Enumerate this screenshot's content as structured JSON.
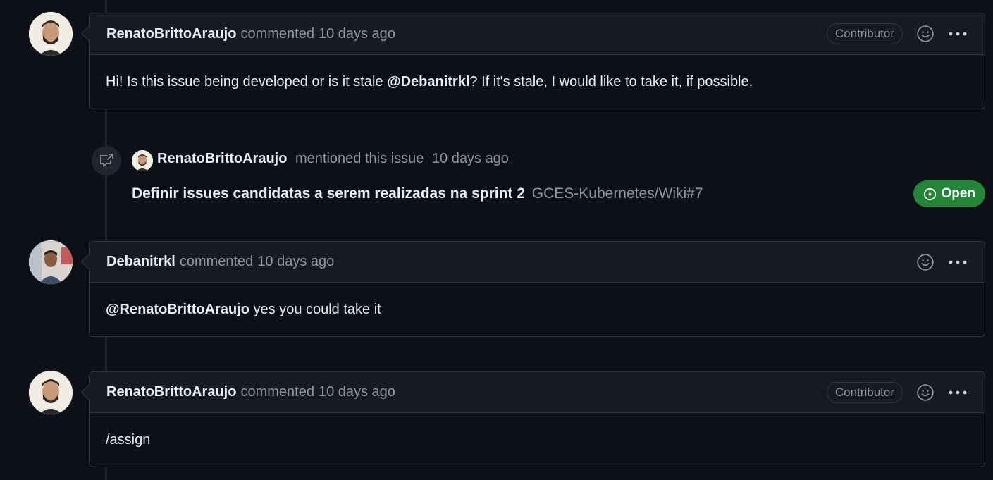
{
  "comments": [
    {
      "author": "RenatoBrittoAraujo",
      "action": "commented",
      "time": "10 days ago",
      "badge": "Contributor",
      "body": {
        "before": "Hi! Is this issue being developed or is it stale ",
        "mention": "@Debanitrkl",
        "after": "? If it's stale, I would like to take it, if possible."
      }
    },
    {
      "author": "Debanitrkl",
      "action": "commented",
      "time": "10 days ago",
      "body": {
        "mention": "@RenatoBrittoAraujo",
        "after": " yes you could take it"
      }
    },
    {
      "author": "RenatoBrittoAraujo",
      "action": "commented",
      "time": "10 days ago",
      "badge": "Contributor",
      "body": {
        "text": "/assign"
      }
    }
  ],
  "mention_event": {
    "author": "RenatoBrittoAraujo",
    "action": "mentioned this issue",
    "time": "10 days ago",
    "ref_title": "Definir issues candidatas a serem realizadas na sprint 2",
    "ref_id": "GCES-Kubernetes/Wiki#7",
    "status": "Open",
    "status_color": "#238636"
  },
  "icons": {
    "reaction": "smiley-icon",
    "menu": "kebab-icon",
    "cross_reference": "cross-reference-icon",
    "open_status": "issue-open-icon"
  }
}
